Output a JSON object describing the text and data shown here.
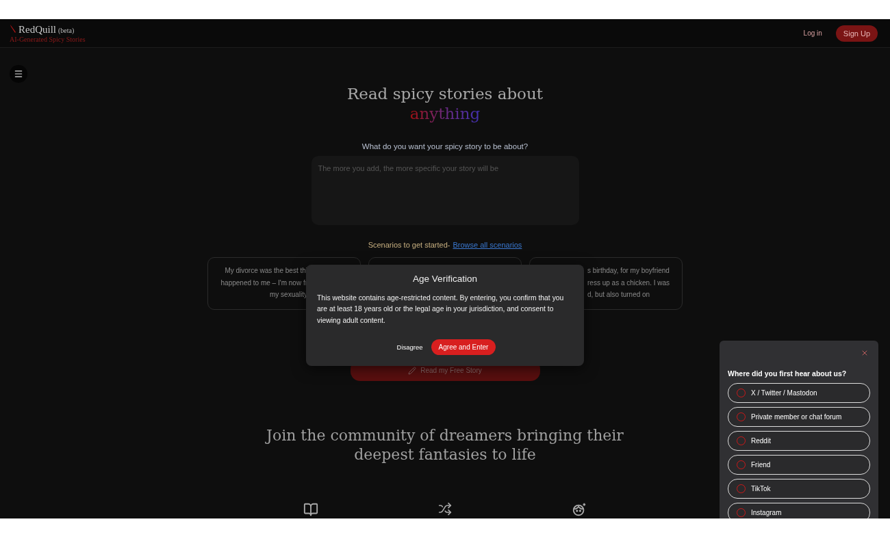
{
  "header": {
    "brand": "RedQuill",
    "badge": "(beta)",
    "tagline": "AI-Generated Spicy Stories",
    "login": "Log in",
    "signup": "Sign Up"
  },
  "hero": {
    "title": "Read spicy stories about",
    "highlight": "anything"
  },
  "prompt": {
    "label": "What do you want your spicy story to be about?",
    "placeholder": "The more you add, the more specific your story will be"
  },
  "scenarios": {
    "label": "Scenarios to get started-",
    "link": "Browse all scenarios",
    "cards": [
      {
        "kind": "text",
        "lines": [
          "My divorce was the best thi",
          "happened to me – I'm now fr",
          "my sexuality"
        ]
      },
      {
        "kind": "hidden"
      },
      {
        "kind": "text",
        "lines": [
          "s birthday, for my boyfriend",
          "ress up as a chicken. I was",
          "d, but also turned on"
        ]
      }
    ]
  },
  "cta": "Read my Free Story",
  "community": "Join the community of dreamers bringing their deepest fantasies to life",
  "modal": {
    "title": "Age Verification",
    "body": "This website contains age-restricted content. By entering, you confirm that you are at least 18 years old or the legal age in your jurisdiction, and consent to viewing adult content.",
    "disagree": "Disagree",
    "agree": "Agree and Enter"
  },
  "survey": {
    "question": "Where did you first hear about us?",
    "options": [
      {
        "label": "X / Twitter / Mastodon",
        "selected": false
      },
      {
        "label": "Private member or chat forum",
        "selected": false
      },
      {
        "label": "Reddit",
        "selected": false
      },
      {
        "label": "Friend",
        "selected": false
      },
      {
        "label": "TikTok",
        "selected": false
      },
      {
        "label": "Instagram",
        "selected": false
      }
    ]
  },
  "features": [
    {
      "kind": "book"
    },
    {
      "kind": "shuffle"
    },
    {
      "kind": "face"
    }
  ]
}
